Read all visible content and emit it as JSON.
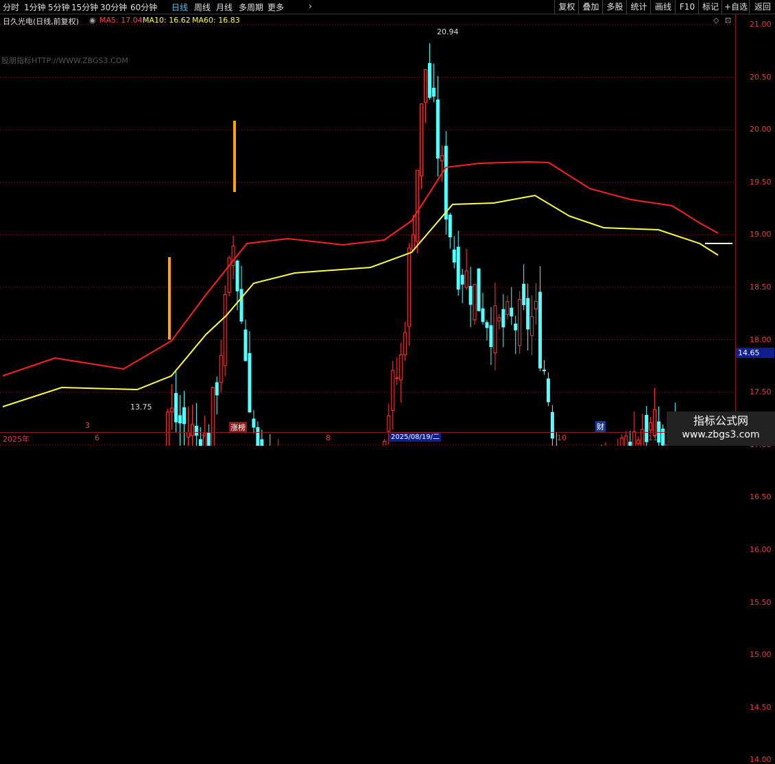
{
  "toolbar": {
    "periods": [
      "分时",
      "1分钟",
      "5分钟",
      "15分钟",
      "30分钟",
      "60分钟",
      "日线",
      "周线",
      "月线",
      "多周期",
      "更多"
    ],
    "active_period": "日线",
    "right_buttons": [
      "复权",
      "叠加",
      "多股",
      "统计",
      "画线",
      "F10",
      "标记",
      "+自选",
      "返回"
    ]
  },
  "info": {
    "stock_title": "日久光电(日线,前复权)",
    "ma5": "MA5: 17.04",
    "ma10": "MA10: 16.62",
    "ma60": "MA60: 16.83"
  },
  "watermark": "股朋指标HTTP://WWW.ZBGS3.COM",
  "y_axis": {
    "ticks": [
      "21.00",
      "20.50",
      "20.00",
      "19.50",
      "19.00",
      "18.50",
      "18.00",
      "17.50",
      "17.00",
      "16.50",
      "16.00",
      "15.50",
      "15.00",
      "14.50",
      "14.00"
    ],
    "current_price": "14.65"
  },
  "annotations": {
    "high": "20.94",
    "low": "13.75"
  },
  "time_axis": {
    "labels": [
      "2025年",
      "6",
      "7",
      "8",
      "10",
      "11"
    ],
    "selected_date": "2025/08/19/二"
  },
  "events": {
    "e1": "3",
    "e2": "涨榜",
    "e3": "财"
  },
  "brand": {
    "line1": "指标公式网",
    "line2": "www.zbgs3.com"
  },
  "colors": {
    "up": "#ff3b3b",
    "down": "#54ffff",
    "ma_red": "#ff2020",
    "ma_yellow": "#ffff40",
    "grid": "#8b1a1a"
  }
}
